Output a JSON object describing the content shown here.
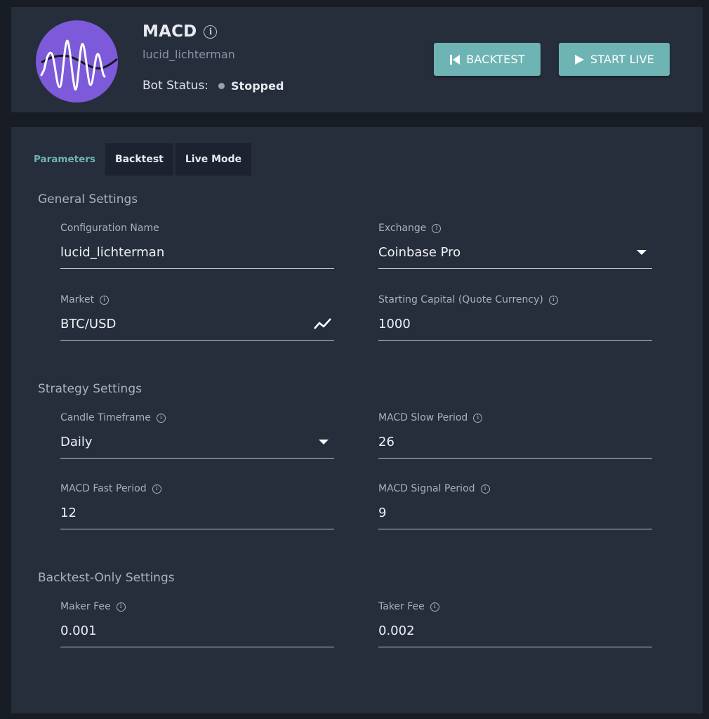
{
  "header": {
    "title": "MACD",
    "subtitle": "lucid_lichterman",
    "status_label": "Bot Status:",
    "status_value": "Stopped",
    "buttons": {
      "backtest": "BACKTEST",
      "start_live": "START LIVE"
    }
  },
  "tabs": [
    {
      "label": "Parameters",
      "active": true
    },
    {
      "label": "Backtest",
      "active": false
    },
    {
      "label": "Live Mode",
      "active": false
    }
  ],
  "sections": {
    "general": {
      "title": "General Settings",
      "configuration_name": {
        "label": "Configuration Name",
        "value": "lucid_lichterman"
      },
      "exchange": {
        "label": "Exchange",
        "value": "Coinbase Pro"
      },
      "market": {
        "label": "Market",
        "value": "BTC/USD"
      },
      "starting_capital": {
        "label": "Starting Capital (Quote Currency)",
        "value": "1000"
      }
    },
    "strategy": {
      "title": "Strategy Settings",
      "candle_timeframe": {
        "label": "Candle Timeframe",
        "value": "Daily"
      },
      "macd_slow": {
        "label": "MACD Slow Period",
        "value": "26"
      },
      "macd_fast": {
        "label": "MACD Fast Period",
        "value": "12"
      },
      "macd_signal": {
        "label": "MACD Signal Period",
        "value": "9"
      }
    },
    "backtest_only": {
      "title": "Backtest-Only Settings",
      "maker_fee": {
        "label": "Maker Fee",
        "value": "0.001"
      },
      "taker_fee": {
        "label": "Taker Fee",
        "value": "0.002"
      }
    }
  },
  "colors": {
    "background": "#181c25",
    "panel": "#262d3b",
    "accent": "#6fb4b4",
    "avatar": "#7c5ad9",
    "status_dot": "#9aa2b0"
  },
  "icons": {
    "info": "info-icon",
    "dropdown": "caret-down-icon",
    "market_chart": "trend-chart-icon",
    "backtest": "skip-back-icon",
    "start_live": "play-icon"
  }
}
